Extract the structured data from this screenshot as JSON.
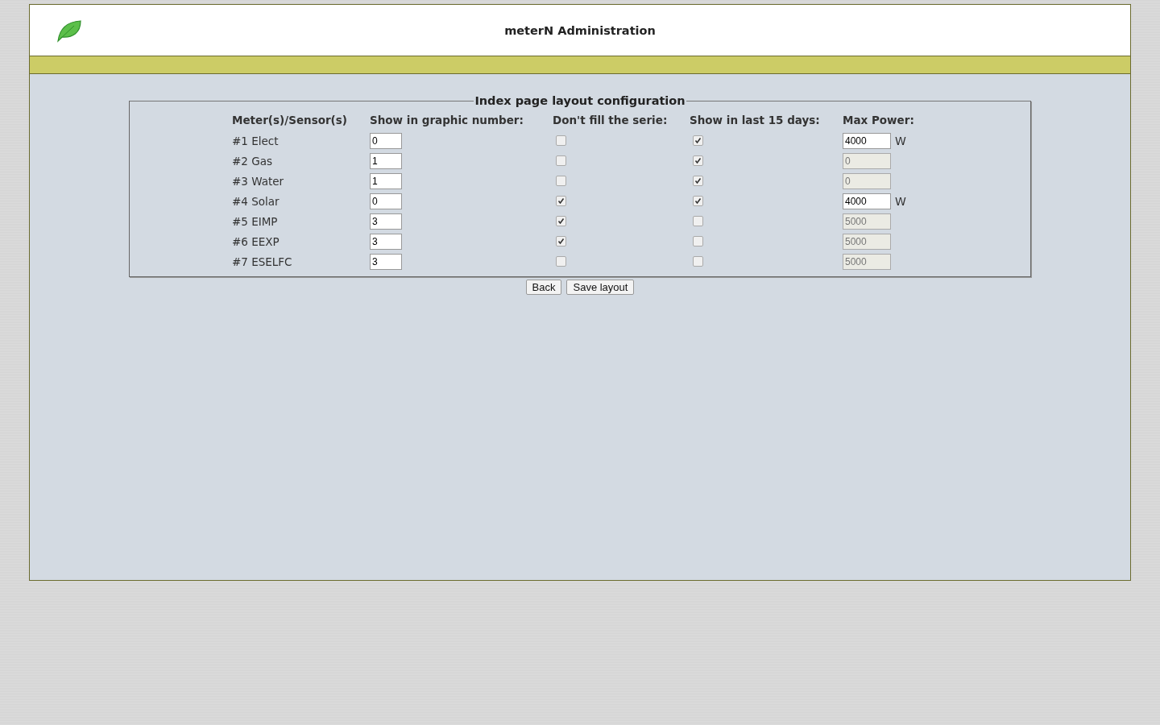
{
  "header": {
    "title": "meterN Administration"
  },
  "fieldset": {
    "legend": "Index page layout configuration",
    "columns": [
      "Meter(s)/Sensor(s)",
      "Show in graphic number:",
      "Don't fill the serie:",
      "Show in last 15 days:",
      "Max Power:"
    ],
    "rows": [
      {
        "name": "#1 Elect",
        "graphic_number": "0",
        "no_fill": false,
        "last_15_days": true,
        "max_power": "4000",
        "max_power_disabled": false,
        "unit": "W"
      },
      {
        "name": "#2 Gas",
        "graphic_number": "1",
        "no_fill": false,
        "last_15_days": true,
        "max_power": "0",
        "max_power_disabled": true
      },
      {
        "name": "#3 Water",
        "graphic_number": "1",
        "no_fill": false,
        "last_15_days": true,
        "max_power": "0",
        "max_power_disabled": true
      },
      {
        "name": "#4 Solar",
        "graphic_number": "0",
        "no_fill": true,
        "last_15_days": true,
        "max_power": "4000",
        "max_power_disabled": false,
        "unit": "W"
      },
      {
        "name": "#5 EIMP",
        "graphic_number": "3",
        "no_fill": true,
        "last_15_days": false,
        "max_power": "5000",
        "max_power_disabled": true
      },
      {
        "name": "#6 EEXP",
        "graphic_number": "3",
        "no_fill": true,
        "last_15_days": false,
        "max_power": "5000",
        "max_power_disabled": true
      },
      {
        "name": "#7 ESELFC",
        "graphic_number": "3",
        "no_fill": false,
        "last_15_days": false,
        "max_power": "5000",
        "max_power_disabled": true
      }
    ]
  },
  "buttons": [
    "Back",
    "Save layout"
  ]
}
